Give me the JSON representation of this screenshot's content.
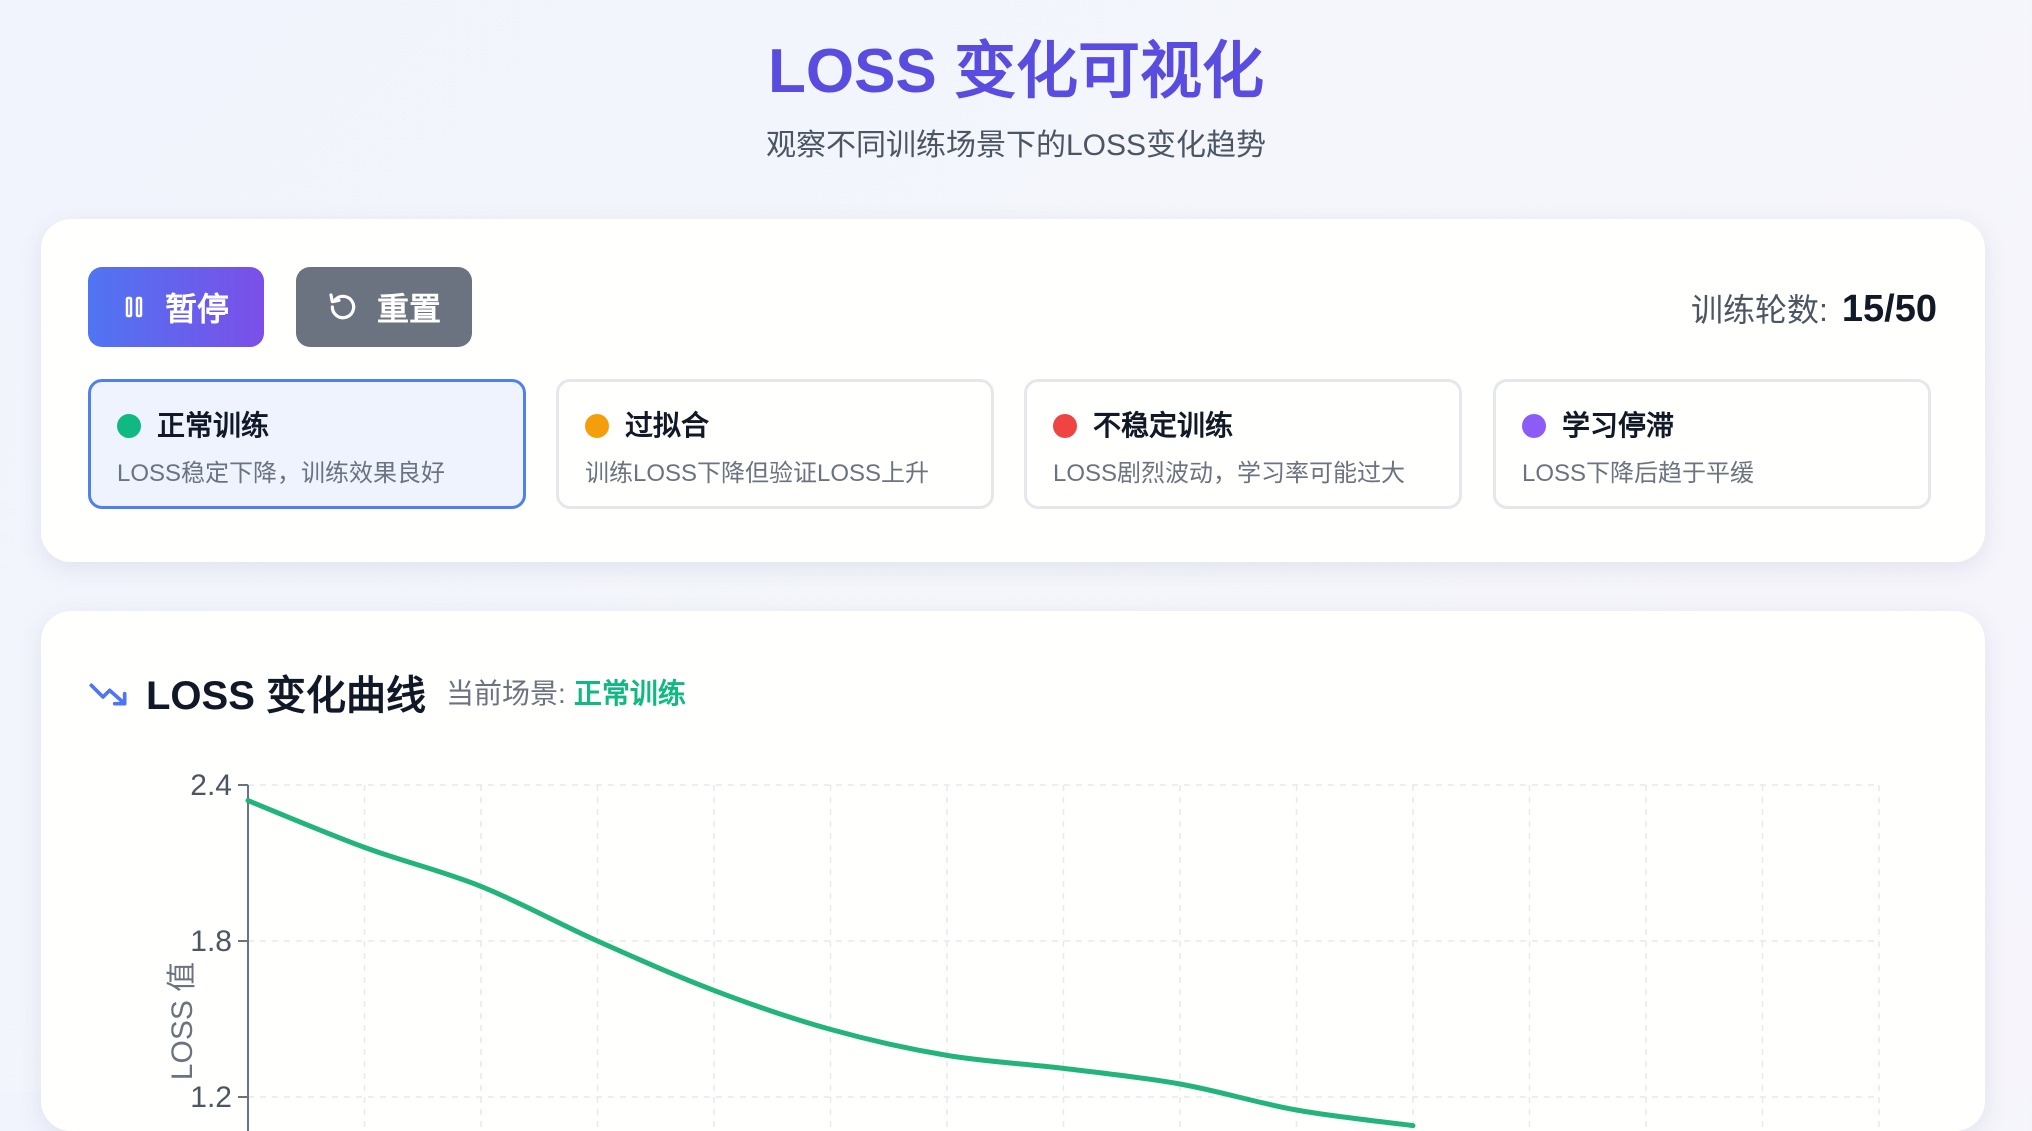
{
  "header": {
    "title": "LOSS 变化可视化",
    "subtitle": "观察不同训练场景下的LOSS变化趋势"
  },
  "controls": {
    "pause_label": "暂停",
    "reset_label": "重置",
    "epoch_label": "训练轮数:",
    "epoch_value": "15/50"
  },
  "scenarios": [
    {
      "name": "正常训练",
      "desc": "LOSS稳定下降，训练效果良好",
      "color": "#10b981",
      "active": true
    },
    {
      "name": "过拟合",
      "desc": "训练LOSS下降但验证LOSS上升",
      "color": "#f59e0b",
      "active": false
    },
    {
      "name": "不稳定训练",
      "desc": "LOSS剧烈波动，学习率可能过大",
      "color": "#ef4444",
      "active": false
    },
    {
      "name": "学习停滞",
      "desc": "LOSS下降后趋于平缓",
      "color": "#8b5cf6",
      "active": false
    }
  ],
  "chart_section": {
    "title": "LOSS 变化曲线",
    "scene_label": "当前场景:",
    "scene_value": "正常训练",
    "icon": "trending-down-icon"
  },
  "chart_data": {
    "type": "line",
    "ylabel": "LOSS 值",
    "y_ticks": [
      "2.4",
      "1.8",
      "1.2"
    ],
    "y_tick_values": [
      2.4,
      1.8,
      1.2
    ],
    "ylim": [
      1.2,
      2.4
    ],
    "grid": true,
    "series": [
      {
        "color": "#22b47a",
        "x": [
          1,
          2,
          3,
          4,
          5,
          6,
          7,
          8,
          9,
          10,
          11
        ],
        "y": [
          2.34,
          2.16,
          2.01,
          1.8,
          1.61,
          1.46,
          1.36,
          1.31,
          1.25,
          1.15,
          1.09
        ]
      }
    ]
  }
}
